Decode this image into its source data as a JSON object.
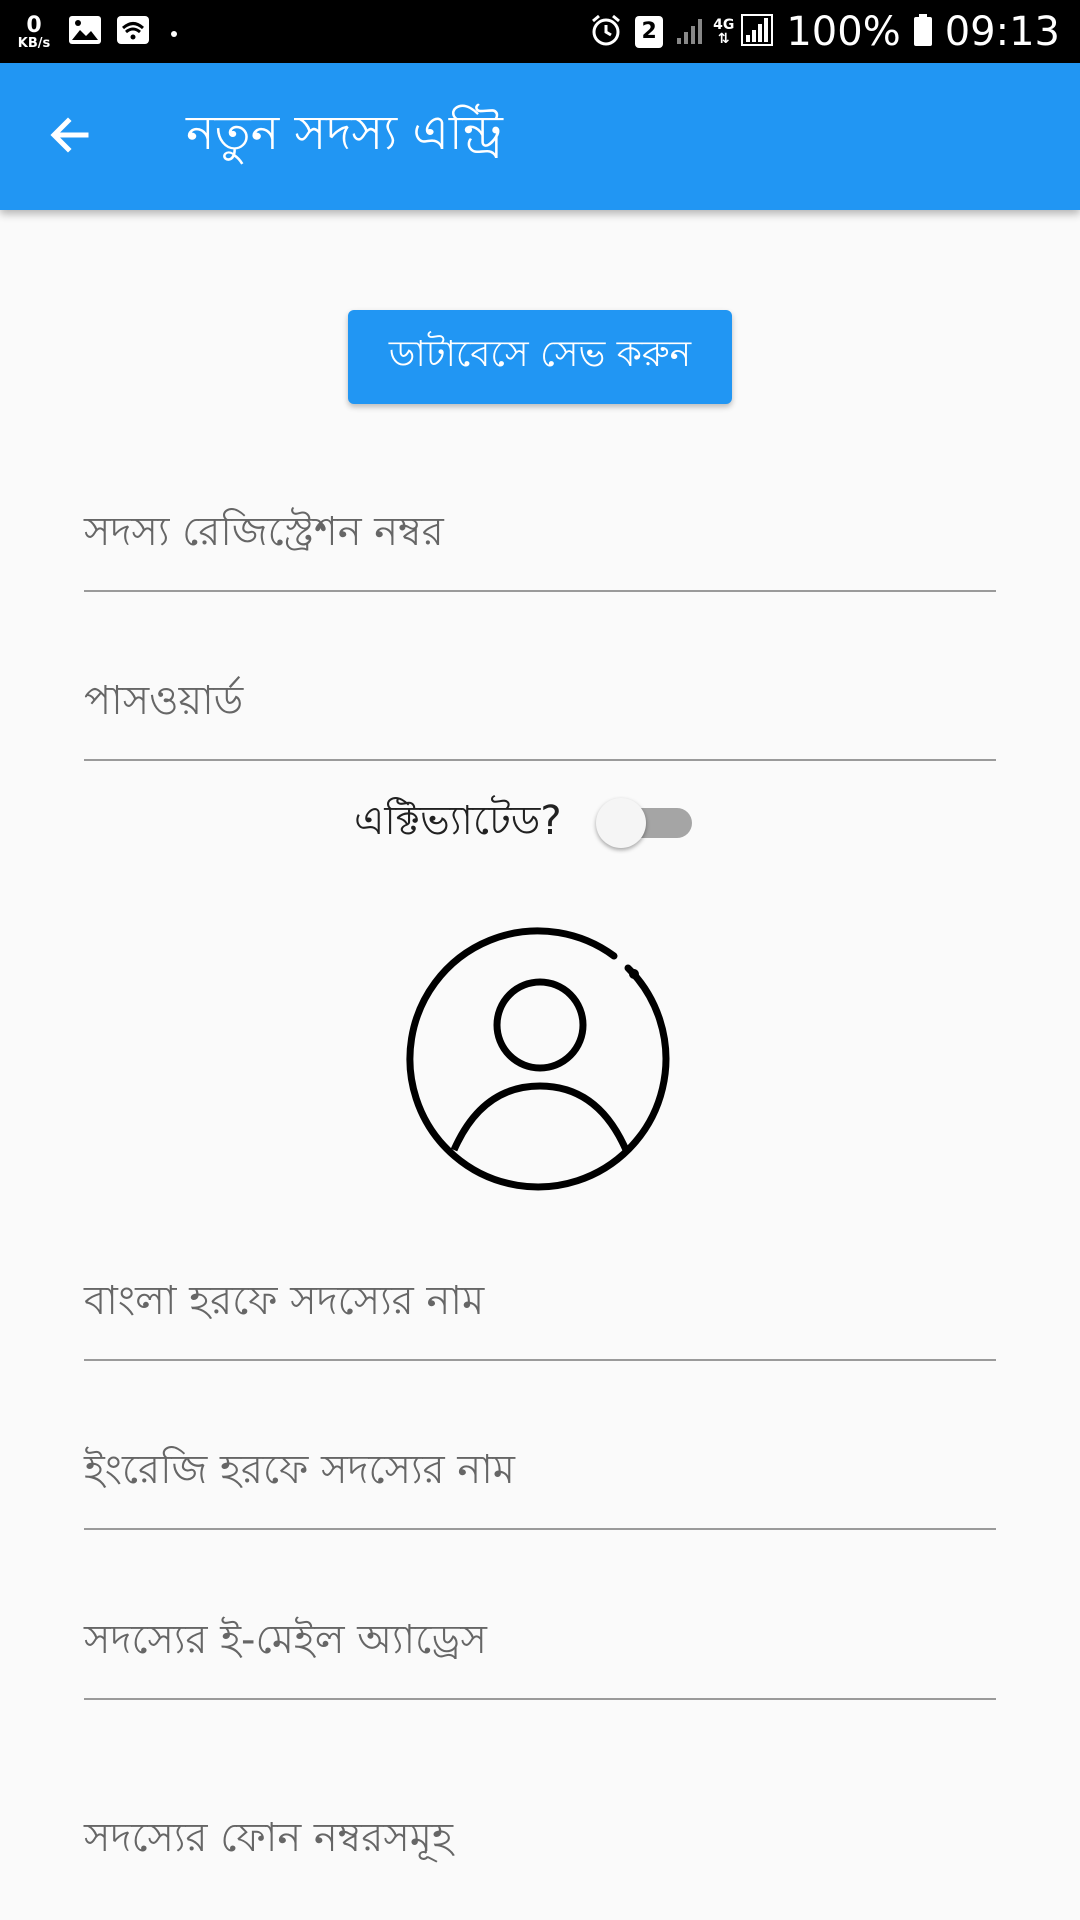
{
  "status_bar": {
    "net_speed_value": "0",
    "net_speed_unit": "KB/s",
    "sim_slot": "2",
    "network_type": "4G",
    "battery": "100%",
    "time": "09:13"
  },
  "app_bar": {
    "title": "নতুন সদস্য এন্ট্রি"
  },
  "save_button": {
    "label": "ডাটাবেসে সেভ করুন"
  },
  "fields": {
    "registration_number": {
      "placeholder": "সদস্য রেজিস্ট্রেশন নম্বর",
      "value": ""
    },
    "password": {
      "placeholder": "পাসওয়ার্ড",
      "value": ""
    },
    "name_bangla": {
      "placeholder": "বাংলা হরফে সদস্যের নাম",
      "value": ""
    },
    "name_english": {
      "placeholder": "ইংরেজি হরফে সদস্যের নাম",
      "value": ""
    },
    "email": {
      "placeholder": "সদস্যের ই-মেইল অ্যাড্রেস",
      "value": ""
    },
    "phone_numbers": {
      "placeholder": "সদস্যের ফোন নম্বরসমূহ",
      "value": ""
    }
  },
  "activated": {
    "label": "এক্টিভ্যাটেড?",
    "on": false
  },
  "colors": {
    "primary": "#2196f3",
    "background": "#fafafa",
    "divider": "#9a9a9a"
  },
  "icons": {
    "back": "arrow-left-icon",
    "avatar": "account-circle-icon"
  }
}
